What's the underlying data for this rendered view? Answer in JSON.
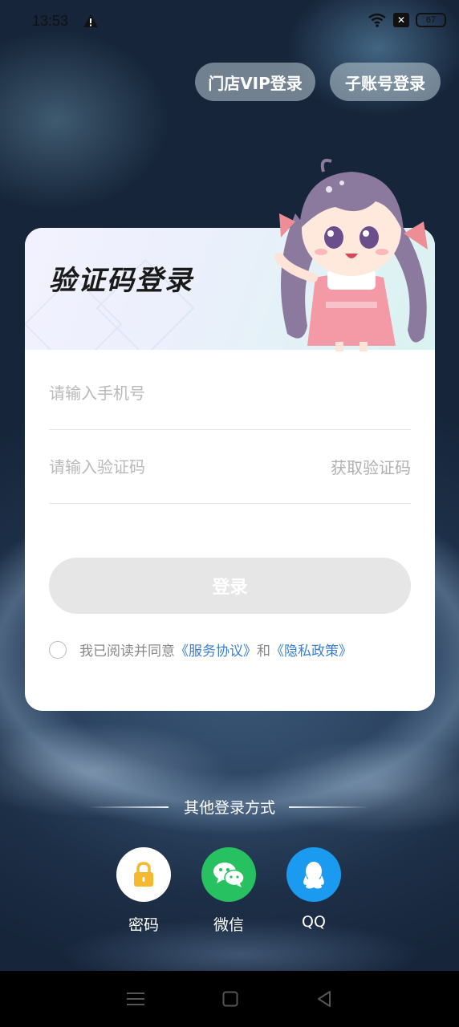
{
  "status": {
    "time": "13:53",
    "battery": "67"
  },
  "top_buttons": {
    "vip": "门店VIP登录",
    "sub": "子账号登录"
  },
  "card": {
    "title": "验证码登录",
    "phone_placeholder": "请输入手机号",
    "code_placeholder": "请输入验证码",
    "get_code": "获取验证码",
    "login": "登录",
    "agree_prefix": "我已阅读并同意",
    "service": "《服务协议》",
    "and": "和",
    "privacy": "《隐私政策》"
  },
  "other": {
    "title": "其他登录方式",
    "methods": [
      {
        "label": "密码",
        "icon": "lock-icon"
      },
      {
        "label": "微信",
        "icon": "wechat-icon"
      },
      {
        "label": "QQ",
        "icon": "qq-icon"
      }
    ]
  },
  "colors": {
    "link": "#3a7fd0",
    "wechat": "#27c161",
    "qq": "#1a9bf0",
    "lock": "#f5b82e"
  },
  "nav": {
    "icons": [
      "menu-icon",
      "home-square-icon",
      "back-triangle-icon"
    ]
  }
}
